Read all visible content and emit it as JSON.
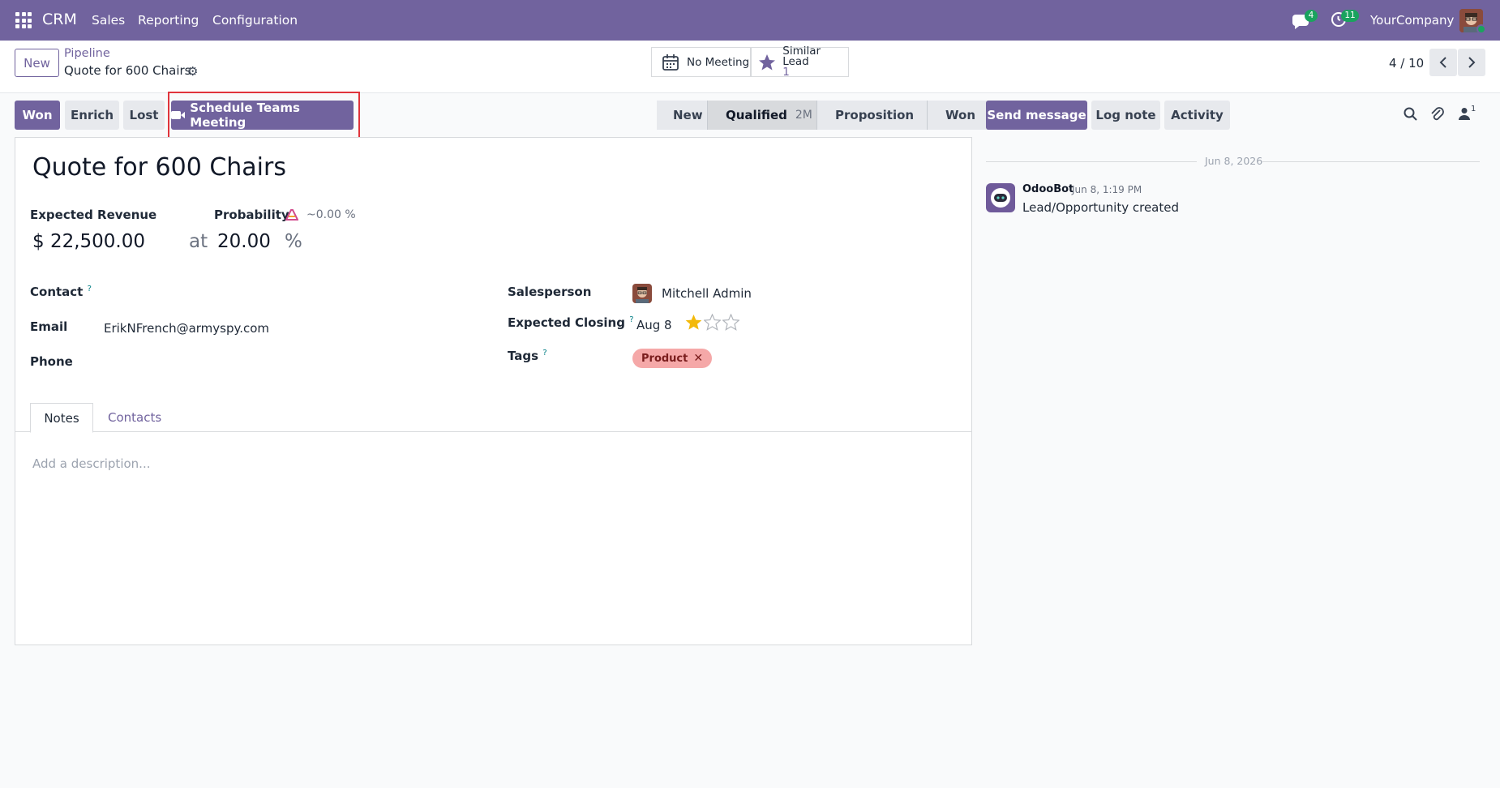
{
  "navbar": {
    "app_name": "CRM",
    "menus": [
      "Sales",
      "Reporting",
      "Configuration"
    ],
    "messages_count": "4",
    "activities_count": "11",
    "company": "YourCompany"
  },
  "control_panel": {
    "new_label": "New",
    "breadcrumb_parent": "Pipeline",
    "breadcrumb_current": "Quote for 600 Chairs",
    "smart_buttons": {
      "meeting_label": "No Meeting",
      "similar_label": "Similar Lead",
      "similar_count": "1"
    },
    "pager": "4 / 10"
  },
  "status_buttons": {
    "won": "Won",
    "enrich": "Enrich",
    "lost": "Lost",
    "teams": "Schedule Teams Meeting"
  },
  "stages": [
    {
      "label": "New",
      "extra": ""
    },
    {
      "label": "Qualified",
      "extra": "2M"
    },
    {
      "label": "Proposition",
      "extra": ""
    },
    {
      "label": "Won",
      "extra": ""
    }
  ],
  "form": {
    "title": "Quote for 600 Chairs",
    "expected_revenue_label": "Expected Revenue",
    "expected_revenue": "$ 22,500.00",
    "at_label": "at",
    "probability_label": "Probability",
    "ai_probability": "~0.00 %",
    "probability": "20.00",
    "percent": "%",
    "contact_label": "Contact",
    "email_label": "Email",
    "email": "ErikNFrench@armyspy.com",
    "phone_label": "Phone",
    "salesperson_label": "Salesperson",
    "salesperson": "Mitchell Admin",
    "expected_closing_label": "Expected Closing",
    "expected_closing": "Aug 8",
    "priority_stars": 1,
    "tags_label": "Tags",
    "tag": "Product",
    "tab_notes": "Notes",
    "tab_contacts": "Contacts",
    "description_placeholder": "Add a description..."
  },
  "chatter": {
    "send_message": "Send message",
    "log_note": "Log note",
    "activity": "Activity",
    "followers_count": "1",
    "date_separator": "Jun 8, 2026",
    "author": "OdooBot",
    "time": "Jun 8, 1:19 PM",
    "message": "Lead/Opportunity created"
  },
  "colors": {
    "brand": "#71639e",
    "badge": "#1aa35e",
    "tag_bg": "#f5a8a8",
    "highlight": "#e0343c",
    "star": "#f3b90a"
  }
}
